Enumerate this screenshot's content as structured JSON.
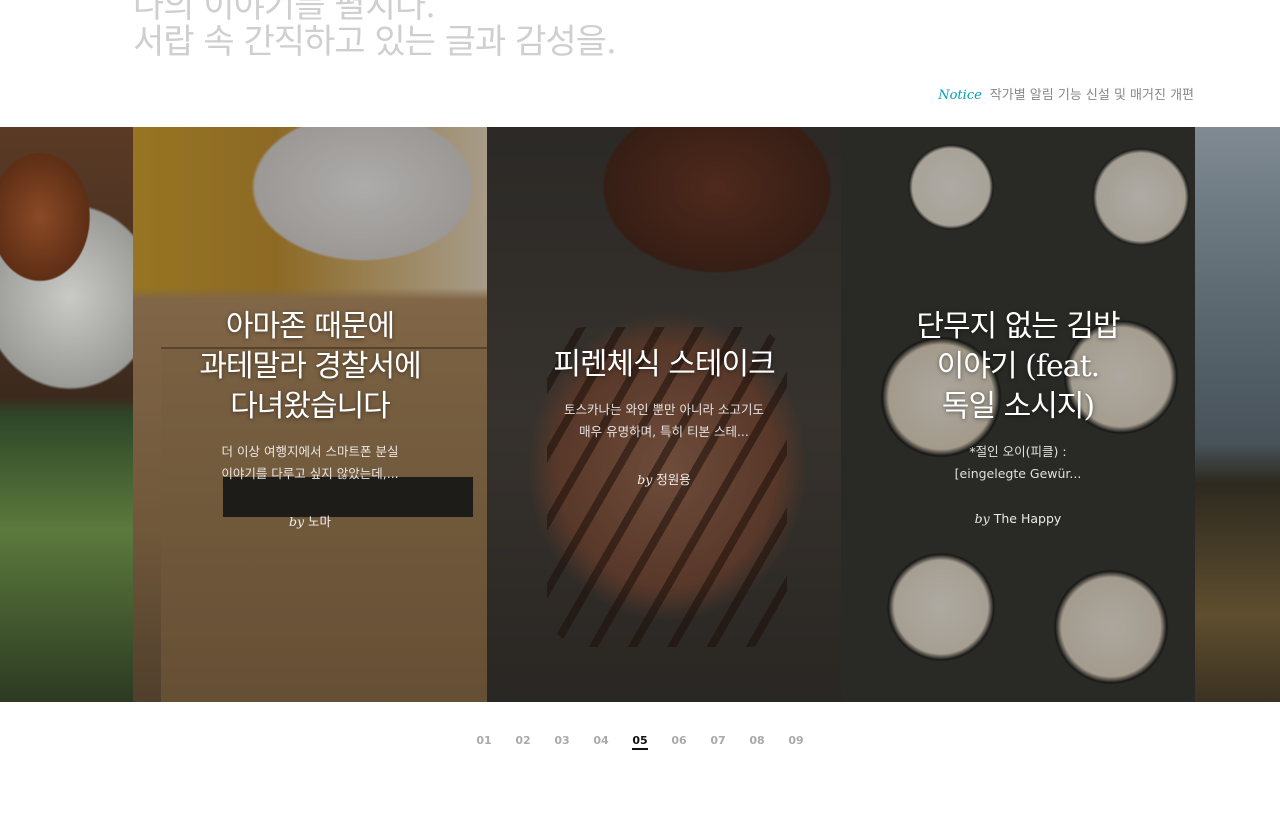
{
  "hero": {
    "line_top": "나의 이야기를 펼치다.",
    "line_main": "서랍 속 간직하고 있는 글과 감성을."
  },
  "notice": {
    "label": "Notice",
    "text": "작가별 알림 기능 신설 및 매거진 개편"
  },
  "cards": [
    {
      "title": "아마존 때문에\n과테말라 경찰서에\n다녀왔습니다",
      "desc": "더 이상 여행지에서 스마트폰 분실\n이야기를 다루고 싶지 않았는데,...",
      "by": "by",
      "author": "노마"
    },
    {
      "title": "피렌체식 스테이크",
      "desc": "토스카나는 와인 뿐만 아니라 소고기도\n매우 유명하며, 특히 티본 스테...",
      "by": "by",
      "author": "정원용"
    },
    {
      "title": "단무지 없는 김밥\n이야기 (feat.\n독일 소시지)",
      "desc": "*절인 오이(피클) :\n[eingelegte Gewür...",
      "by": "by",
      "author": "The Happy"
    }
  ],
  "pager": {
    "pages": [
      "01",
      "02",
      "03",
      "04",
      "05",
      "06",
      "07",
      "08",
      "09"
    ],
    "active": "05"
  },
  "colors": {
    "accent": "#00a0b4",
    "hero_text": "#cfcfcf",
    "notice_text": "#888888"
  }
}
